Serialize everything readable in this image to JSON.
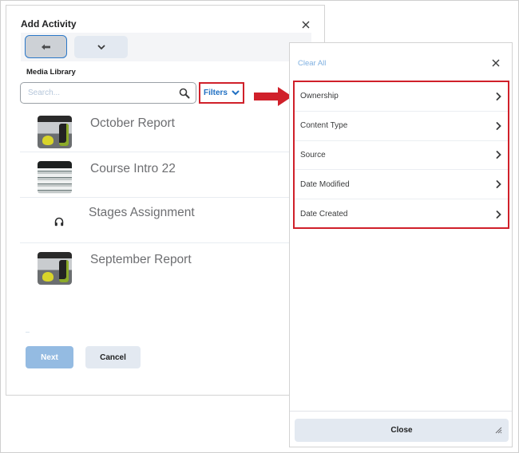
{
  "dialog": {
    "title": "Add Activity",
    "close_icon": "close-icon",
    "toolbar": {
      "back_icon": "arrow-left-icon",
      "dropdown_icon": "chevron-down-icon"
    },
    "section_label": "Media Library",
    "search": {
      "value": "",
      "placeholder": "Search...",
      "icon": "search-icon"
    },
    "filters_label": "Filters",
    "media_items": [
      {
        "title": "October Report",
        "type": "video"
      },
      {
        "title": "Course Intro 22",
        "type": "video"
      },
      {
        "title": "Stages Assignment",
        "type": "audio"
      },
      {
        "title": "September Report",
        "type": "video"
      }
    ],
    "buttons": {
      "next": "Next",
      "cancel": "Cancel"
    }
  },
  "filter_panel": {
    "clear_all": "Clear All",
    "filters": [
      {
        "label": "Ownership"
      },
      {
        "label": "Content Type"
      },
      {
        "label": "Source"
      },
      {
        "label": "Date Modified"
      },
      {
        "label": "Date Created"
      }
    ],
    "close_label": "Close"
  },
  "colors": {
    "accent_blue": "#1f6fc2",
    "highlight_red": "#d0202a",
    "primary_disabled": "#94bbe2",
    "secondary_bg": "#e3e9f1"
  }
}
